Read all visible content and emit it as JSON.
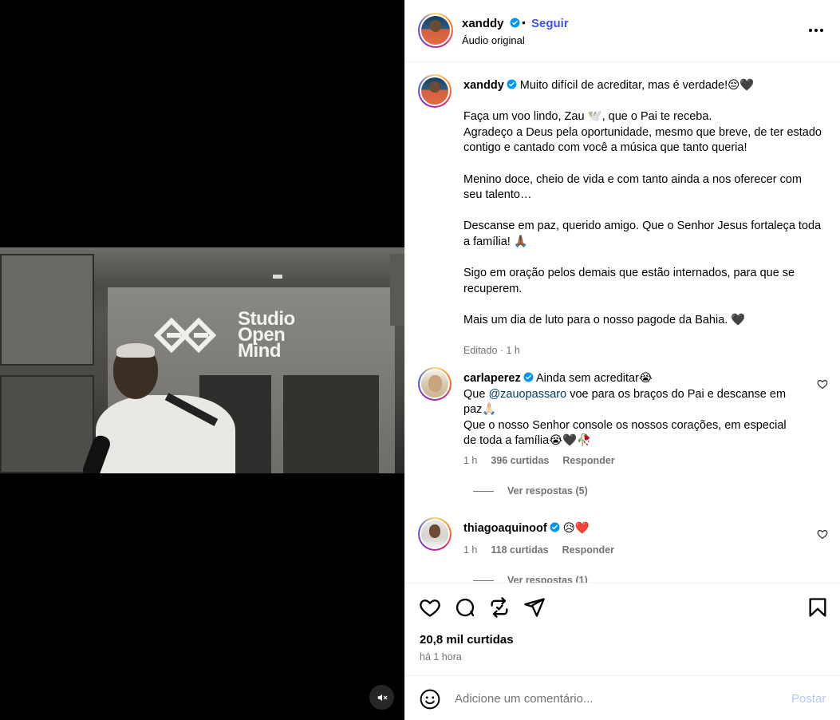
{
  "post": {
    "username": "xanddy",
    "separator": "•",
    "follow_label": "Seguir",
    "audio_label": "Áudio original",
    "more_icon": "more-horizontal-icon"
  },
  "video": {
    "studio_text_line1": "Studio",
    "studio_text_line2": "Open",
    "studio_text_line3": "Mind",
    "muted": true
  },
  "caption": {
    "username": "xanddy",
    "text": " Muito difícil de acreditar, mas é verdade!😔🖤\n\nFaça um voo lindo, Zau 🕊️, que o Pai te receba.\nAgradeço a Deus pela oportunidade, mesmo que breve, de ter estado contigo e cantado com você a música que tanto queria!\n\nMenino doce, cheio de vida e com tanto ainda a nos oferecer com seu talento…\n\nDescanse em paz, querido amigo. Que o Senhor Jesus fortaleça toda a família! 🙏🏾\n\nSigo em oração pelos demais que estão internados, para que se recuperem.\n\nMais um dia de luto para o nosso pagode da Bahia. 🖤",
    "meta": "Editado · 1 h"
  },
  "comments": [
    {
      "username": "carlaperez",
      "text_before": " Ainda sem acreditar😭",
      "line2_prefix": "Que ",
      "mention": "@zauopassaro",
      "text_after": " voe para os braços do Pai e descanse em paz🙏🏻",
      "text_end": "Que o nosso Senhor console os nossos corações, em especial de toda a família😭🖤🥀",
      "time": "1 h",
      "likes": "396 curtidas",
      "reply_label": "Responder",
      "view_replies": "Ver respostas (5)"
    },
    {
      "username": "thiagoaquinoof",
      "text_before": " 😥❤️",
      "time": "1 h",
      "likes": "118 curtidas",
      "reply_label": "Responder",
      "view_replies": "Ver respostas (1)"
    }
  ],
  "actions": {
    "like_icon": "heart-icon",
    "comment_icon": "comment-icon",
    "repost_icon": "repost-icon",
    "share_icon": "share-icon",
    "save_icon": "bookmark-icon",
    "likes_count": "20,8 mil curtidas",
    "time_ago": "há 1 hora"
  },
  "composer": {
    "placeholder": "Adicione um comentário...",
    "post_label": "Postar",
    "post_color": "#b3c7ff"
  },
  "colors": {
    "accent": "#4150f7",
    "verified": "#0095f6",
    "muted_text": "#737373",
    "divider": "#efefef"
  }
}
